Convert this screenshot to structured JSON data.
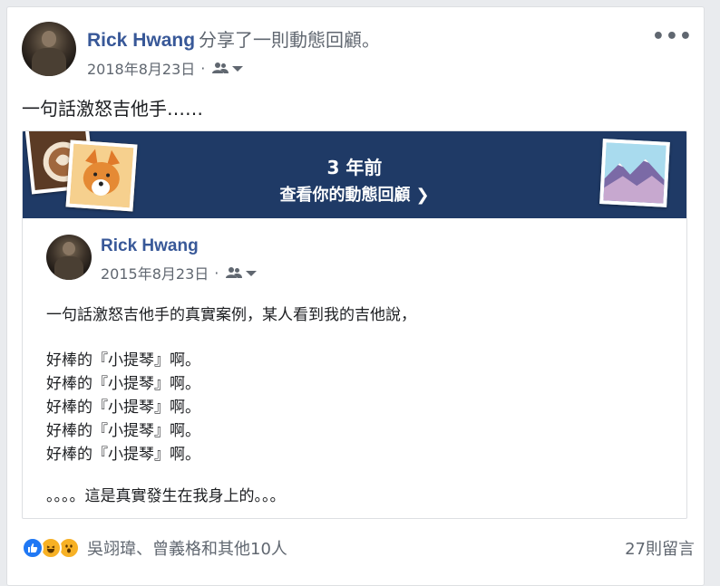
{
  "post": {
    "author": "Rick Hwang",
    "action": "分享了一則動態回顧。",
    "date": "2018年8月23日",
    "dot": "·",
    "text": "一句話激怒吉他手……"
  },
  "memory": {
    "years_ago": "3 年前",
    "link_label": "查看你的動態回顧",
    "original": {
      "author": "Rick Hwang",
      "date": "2015年8月23日",
      "dot": "·",
      "lines": [
        "一句話激怒吉他手的真實案例，某人看到我的吉他說，",
        "好棒的『小提琴』啊。",
        "好棒的『小提琴』啊。",
        "好棒的『小提琴』啊。",
        "好棒的『小提琴』啊。",
        "好棒的『小提琴』啊。",
        "。。。。這是真實發生在我身上的。。。"
      ]
    }
  },
  "footer": {
    "reactors": "吳翊瑋、曾義格和其他10人",
    "comments": "27則留言"
  },
  "icons": {
    "friends": "friends-icon",
    "more": "more-options-icon",
    "like": "like-reaction-icon",
    "haha": "haha-reaction-icon",
    "wow": "wow-reaction-icon"
  },
  "colors": {
    "link": "#385898",
    "banner": "#1f3a66",
    "like": "#2078f4",
    "emoji": "#f7b125"
  }
}
